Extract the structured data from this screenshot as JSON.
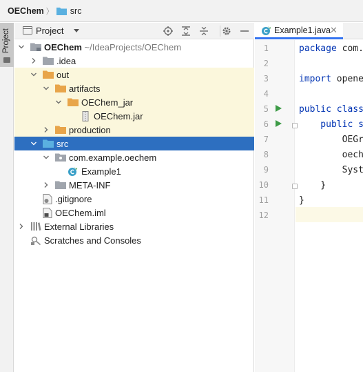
{
  "breadcrumb": {
    "project": "OEChem",
    "folder": "src"
  },
  "stripe": {
    "tab_label": "Project"
  },
  "panel": {
    "title": "Project",
    "tree": [
      {
        "label": "OEChem",
        "suffix": "~/IdeaProjects/OEChem",
        "icon": "module-folder-icon"
      },
      {
        "label": ".idea",
        "icon": "folder-icon"
      },
      {
        "label": "out",
        "icon": "excluded-folder-icon"
      },
      {
        "label": "artifacts",
        "icon": "excluded-folder-icon"
      },
      {
        "label": "OEChem_jar",
        "icon": "excluded-folder-icon"
      },
      {
        "label": "OEChem.jar",
        "icon": "jar-icon"
      },
      {
        "label": "production",
        "icon": "excluded-folder-icon"
      },
      {
        "label": "src",
        "icon": "source-folder-icon"
      },
      {
        "label": "com.example.oechem",
        "icon": "package-icon"
      },
      {
        "label": "Example1",
        "icon": "java-class-icon"
      },
      {
        "label": "META-INF",
        "icon": "folder-icon"
      },
      {
        "label": ".gitignore",
        "icon": "gitignore-file-icon"
      },
      {
        "label": "OEChem.iml",
        "icon": "iml-file-icon"
      },
      {
        "label": "External Libraries",
        "icon": "libraries-icon"
      },
      {
        "label": "Scratches and Consoles",
        "icon": "scratches-icon"
      }
    ]
  },
  "editor": {
    "tab_label": "Example1.java",
    "line_numbers": [
      "1",
      "2",
      "3",
      "4",
      "5",
      "6",
      "7",
      "8",
      "9",
      "10",
      "11",
      "12"
    ],
    "code": [
      {
        "kw": "package",
        "rest": " com."
      },
      {
        "kw": "",
        "rest": ""
      },
      {
        "kw": "import",
        "rest": " opene"
      },
      {
        "kw": "",
        "rest": ""
      },
      {
        "kw": "public class",
        "rest": ""
      },
      {
        "kw": "    public s",
        "rest": ""
      },
      {
        "kw": "",
        "rest": "        OEGr"
      },
      {
        "kw": "",
        "rest": "        oech"
      },
      {
        "kw": "",
        "rest": "        Syst"
      },
      {
        "kw": "",
        "rest": "    }"
      },
      {
        "kw": "",
        "rest": "}"
      },
      {
        "kw": "",
        "rest": ""
      }
    ]
  },
  "colors": {
    "selection": "#2d6fc0",
    "excluded_highlight": "#fbf7dc",
    "folder_orange": "#e8a54a",
    "source_blue": "#5ab0e0",
    "run_green": "#3d9b47"
  }
}
